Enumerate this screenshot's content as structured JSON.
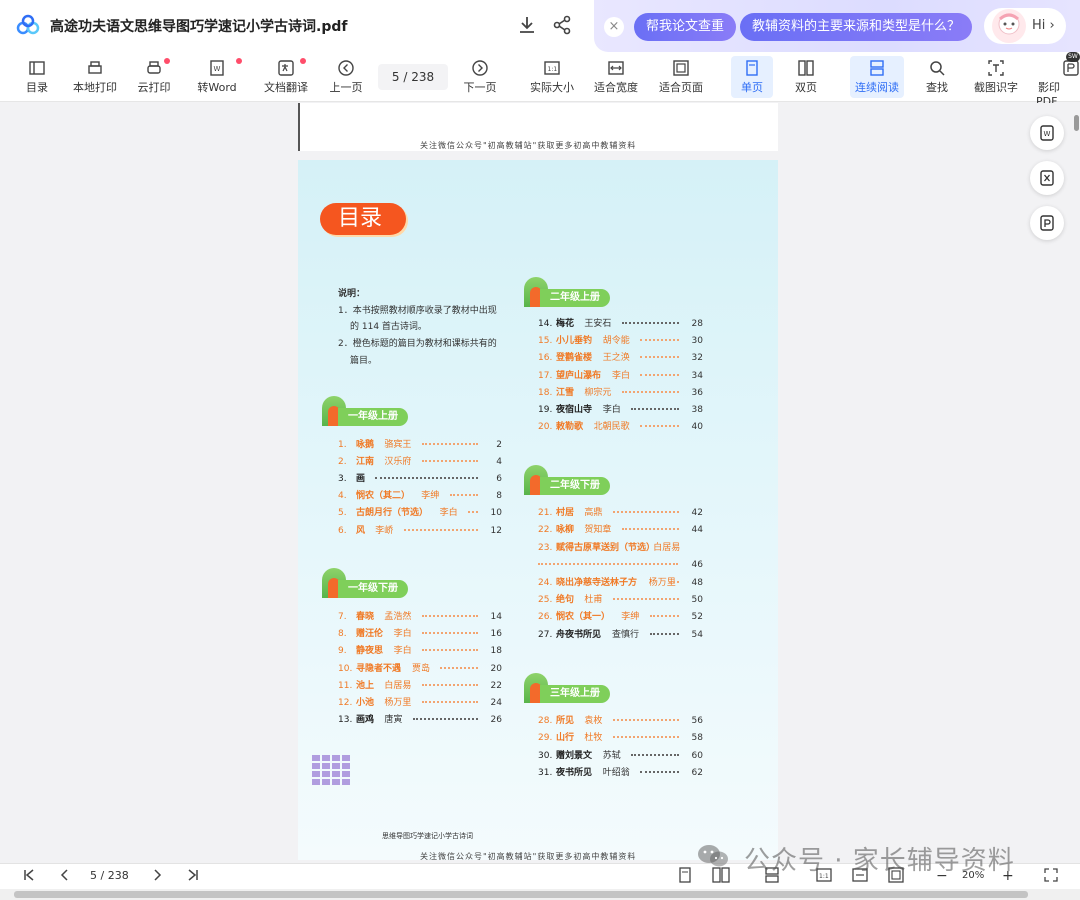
{
  "titlebar": {
    "doc_title": "高途功夫语文思维导图巧学速记小学古诗词.pdf",
    "ai_close": "×",
    "ai_prompt_1": "帮我论文查重",
    "ai_prompt_2": "教辅资料的主要来源和类型是什么？",
    "hi_text": "Hi ›"
  },
  "toolbar": {
    "toc": "目录",
    "local_print": "本地打印",
    "cloud_print": "云打印",
    "to_word": "转Word",
    "translate": "文档翻译",
    "prev_page": "上一页",
    "page_indicator": "5   / 238",
    "next_page": "下一页",
    "actual_size": "实际大小",
    "fit_width": "适合宽度",
    "fit_page": "适合页面",
    "single_page": "单页",
    "double_page": "双页",
    "continuous": "连续阅读",
    "find": "查找",
    "ocr": "截图识字",
    "print_pdf": "影印PDF",
    "badge_sw": "SW"
  },
  "document": {
    "footer_top": "关注微信公众号\"初高教辅站\"获取更多初高中教辅资料",
    "footer_bottom": "关注微信公众号\"初高教辅站\"获取更多初高中教辅资料",
    "book_name": "思维导图巧学速记小学古诗词",
    "toc_title": "目录",
    "note_title": "说明：",
    "note_1a": "1．本书按照教材顺序收录了教材中出现",
    "note_1b": "的 114 首古诗词。",
    "note_2a": "2．橙色标题的篇目为教材和课标共有的",
    "note_2b": "篇目。",
    "grades": {
      "g1a": "一年级上册",
      "g1b": "一年级下册",
      "g2a": "二年级上册",
      "g2b": "二年级下册",
      "g3a": "三年级上册"
    },
    "entries_left": [
      {
        "num": "1.",
        "title": "咏鹅",
        "author": "骆宾王",
        "page": "2",
        "orange": true
      },
      {
        "num": "2.",
        "title": "江南",
        "author": "汉乐府",
        "page": "4",
        "orange": true
      },
      {
        "num": "3.",
        "title": "画",
        "author": "",
        "page": "6",
        "orange": false
      },
      {
        "num": "4.",
        "title": "悯农（其二）",
        "author": "李绅",
        "page": "8",
        "orange": true
      },
      {
        "num": "5.",
        "title": "古朗月行（节选）",
        "author": "李白",
        "page": "10",
        "orange": true
      },
      {
        "num": "6.",
        "title": "风",
        "author": "李峤",
        "page": "12",
        "orange": true
      },
      {
        "num": "7.",
        "title": "春晓",
        "author": "孟浩然",
        "page": "14",
        "orange": true
      },
      {
        "num": "8.",
        "title": "赠汪伦",
        "author": "李白",
        "page": "16",
        "orange": true
      },
      {
        "num": "9.",
        "title": "静夜思",
        "author": "李白",
        "page": "18",
        "orange": true
      },
      {
        "num": "10.",
        "title": "寻隐者不遇",
        "author": "贾岛",
        "page": "20",
        "orange": true
      },
      {
        "num": "11.",
        "title": "池上",
        "author": "白居易",
        "page": "22",
        "orange": true
      },
      {
        "num": "12.",
        "title": "小池",
        "author": "杨万里",
        "page": "24",
        "orange": true
      },
      {
        "num": "13.",
        "title": "画鸡",
        "author": "唐寅",
        "page": "26",
        "orange": false
      }
    ],
    "entries_right": [
      {
        "num": "14.",
        "title": "梅花",
        "author": "王安石",
        "page": "28",
        "orange": false
      },
      {
        "num": "15.",
        "title": "小儿垂钓",
        "author": "胡令能",
        "page": "30",
        "orange": true
      },
      {
        "num": "16.",
        "title": "登鹳雀楼",
        "author": "王之涣",
        "page": "32",
        "orange": true
      },
      {
        "num": "17.",
        "title": "望庐山瀑布",
        "author": "李白",
        "page": "34",
        "orange": true
      },
      {
        "num": "18.",
        "title": "江雪",
        "author": "柳宗元",
        "page": "36",
        "orange": true
      },
      {
        "num": "19.",
        "title": "夜宿山寺",
        "author": "李白",
        "page": "38",
        "orange": false
      },
      {
        "num": "20.",
        "title": "敕勒歌",
        "author": "北朝民歌",
        "page": "40",
        "orange": true
      },
      {
        "num": "21.",
        "title": "村居",
        "author": "高鼎",
        "page": "42",
        "orange": true
      },
      {
        "num": "22.",
        "title": "咏柳",
        "author": "贺知章",
        "page": "44",
        "orange": true
      },
      {
        "num": "23.",
        "title": "赋得古原草送别（节选）",
        "author": "白居易",
        "page": "46",
        "orange": true
      },
      {
        "num": "24.",
        "title": "晓出净慈寺送林子方",
        "author": "杨万里",
        "page": "48",
        "orange": true
      },
      {
        "num": "25.",
        "title": "绝句",
        "author": "杜甫",
        "page": "50",
        "orange": true
      },
      {
        "num": "26.",
        "title": "悯农（其一）",
        "author": "李绅",
        "page": "52",
        "orange": true
      },
      {
        "num": "27.",
        "title": "舟夜书所见",
        "author": "查慎行",
        "page": "54",
        "orange": false
      },
      {
        "num": "28.",
        "title": "所见",
        "author": "袁枚",
        "page": "56",
        "orange": true
      },
      {
        "num": "29.",
        "title": "山行",
        "author": "杜牧",
        "page": "58",
        "orange": true
      },
      {
        "num": "30.",
        "title": "赠刘景文",
        "author": "苏轼",
        "page": "60",
        "orange": false
      },
      {
        "num": "31.",
        "title": "夜书所见",
        "author": "叶绍翁",
        "page": "62",
        "orange": false
      }
    ]
  },
  "statusbar": {
    "page_indicator": "5   / 238",
    "zoom": "20%",
    "zoom_minus": "−",
    "zoom_plus": "+"
  },
  "watermark": {
    "text": "公众号 · 家长辅导资料"
  }
}
